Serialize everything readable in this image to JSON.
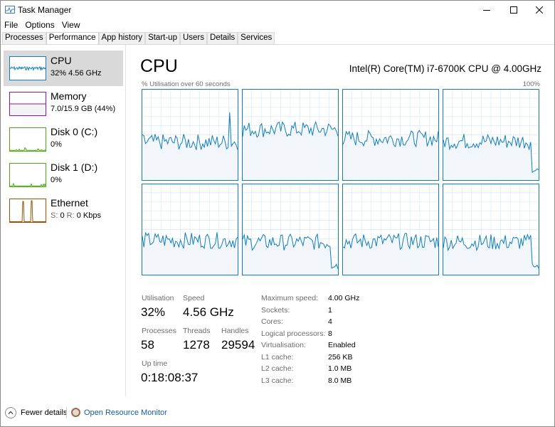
{
  "window": {
    "title": "Task Manager"
  },
  "menu": [
    "File",
    "Options",
    "View"
  ],
  "tabs": [
    {
      "label": "Processes",
      "active": false
    },
    {
      "label": "Performance",
      "active": true
    },
    {
      "label": "App history",
      "active": false
    },
    {
      "label": "Start-up",
      "active": false
    },
    {
      "label": "Users",
      "active": false
    },
    {
      "label": "Details",
      "active": false
    },
    {
      "label": "Services",
      "active": false
    }
  ],
  "sidebar": {
    "items": [
      {
        "title": "CPU",
        "subtitle": "32%  4.56 GHz",
        "color": "#117dbb",
        "fill": "#f1f6fa",
        "selected": true
      },
      {
        "title": "Memory",
        "subtitle": "7.0/15.9 GB (44%)",
        "color": "#8b12ae",
        "fill": "#f4f2f4",
        "selected": false
      },
      {
        "title": "Disk 0 (C:)",
        "subtitle": "0%",
        "color": "#4da60c",
        "fill": "#eff7e9",
        "selected": false
      },
      {
        "title": "Disk 1 (D:)",
        "subtitle": "0%",
        "color": "#4da60c",
        "fill": "#eff7e9",
        "selected": false
      },
      {
        "title": "Ethernet",
        "subtitle_s": "S:",
        "subtitle_sv": "0",
        "subtitle_r": "R:",
        "subtitle_rv": "0 Kbps",
        "color": "#a74f01",
        "fill": "#fcf3eb",
        "selected": false
      }
    ]
  },
  "main": {
    "title": "CPU",
    "model": "Intel(R) Core(TM) i7-6700K CPU @ 4.00GHz",
    "graph_caption": "% Utilisation over 60 seconds",
    "graph_max": "100%",
    "graph_color": "#117dbb",
    "graph_fill": "#f1f6fa",
    "grid_color": "#d9eaf4"
  },
  "stats": {
    "utilisation_label": "Utilisation",
    "utilisation": "32%",
    "speed_label": "Speed",
    "speed": "4.56 GHz",
    "processes_label": "Processes",
    "processes": "58",
    "threads_label": "Threads",
    "threads": "1278",
    "handles_label": "Handles",
    "handles": "29594",
    "uptime_label": "Up time",
    "uptime": "0:18:08:37"
  },
  "specs": [
    {
      "key": "Maximum speed:",
      "value": "4.00 GHz"
    },
    {
      "key": "Sockets:",
      "value": "1"
    },
    {
      "key": "Cores:",
      "value": "4"
    },
    {
      "key": "Logical processors:",
      "value": "8"
    },
    {
      "key": "Virtualisation:",
      "value": "Enabled"
    },
    {
      "key": "L1 cache:",
      "value": "256 KB"
    },
    {
      "key": "L2 cache:",
      "value": "1.0 MB"
    },
    {
      "key": "L3 cache:",
      "value": "8.0 MB"
    }
  ],
  "footer": {
    "fewer_details": "Fewer details",
    "open_resmon": "Open Resource Monitor"
  },
  "icons": {
    "app": "task-manager-icon",
    "minimize": "minimize-icon",
    "maximize": "maximize-icon",
    "close": "close-icon",
    "fewer": "chevron-up-icon",
    "resmon": "resource-monitor-icon"
  }
}
